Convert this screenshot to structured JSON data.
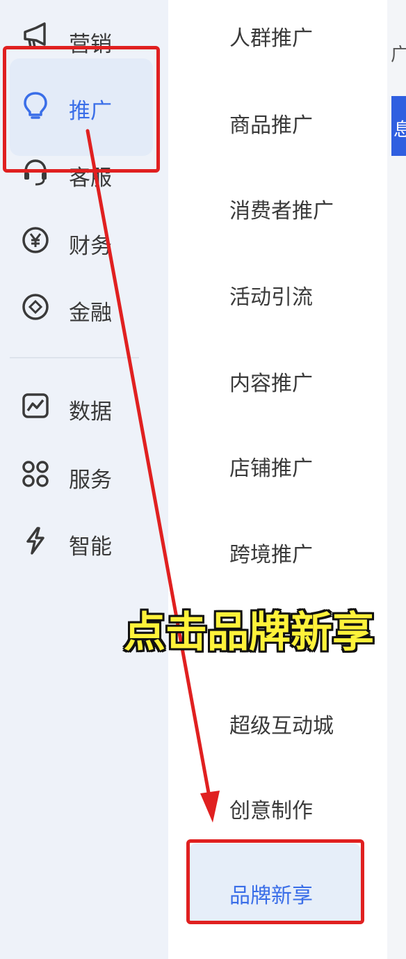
{
  "sidebar": {
    "items": [
      {
        "label": "营销",
        "icon": "megaphone-icon"
      },
      {
        "label": "推广",
        "icon": "lightbulb-icon",
        "active": true
      },
      {
        "label": "客服",
        "icon": "headset-icon"
      },
      {
        "label": "财务",
        "icon": "yen-icon"
      },
      {
        "label": "金融",
        "icon": "diamond-icon"
      },
      {
        "label": "数据",
        "icon": "chart-icon"
      },
      {
        "label": "服务",
        "icon": "grid-icon"
      },
      {
        "label": "智能",
        "icon": "lightning-icon"
      }
    ]
  },
  "submenu": {
    "items": [
      {
        "label": "人群推广"
      },
      {
        "label": "商品推广"
      },
      {
        "label": "消费者推广"
      },
      {
        "label": "活动引流"
      },
      {
        "label": "内容推广"
      },
      {
        "label": "店铺推广"
      },
      {
        "label": "跨境推广"
      },
      {
        "label": "超级互动城"
      },
      {
        "label": "创意制作"
      },
      {
        "label": "品牌新享",
        "active": true
      }
    ]
  },
  "right_partial": {
    "top_glyph": "广",
    "blue_glyph": "息"
  },
  "annotation": {
    "caption": "点击品牌新享",
    "color": "#e02020",
    "caption_color": "#fff23a"
  },
  "colors": {
    "accent": "#3a6ee8"
  }
}
